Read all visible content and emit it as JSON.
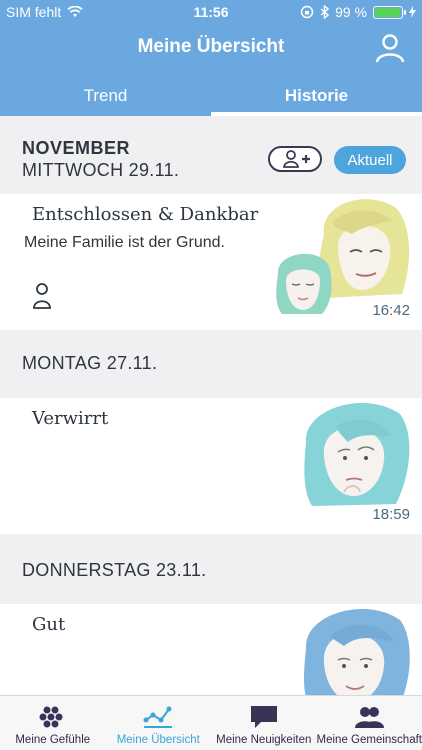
{
  "status": {
    "carrier": "SIM fehlt",
    "time": "11:56",
    "battery": "99 %"
  },
  "header": {
    "title": "Meine Übersicht"
  },
  "tabs": [
    {
      "label": "Trend"
    },
    {
      "label": "Historie"
    }
  ],
  "month_label": "NOVEMBER",
  "current_label": "Aktuell",
  "entries": [
    {
      "day": "MITTWOCH 29.11.",
      "mood": "Entschlossen & Dankbar",
      "note": "Meine Familie ist der Grund.",
      "time": "16:42"
    },
    {
      "day": "MONTAG 27.11.",
      "mood": "Verwirrt",
      "time": "18:59"
    },
    {
      "day": "DONNERSTAG 23.11.",
      "mood": "Gut"
    }
  ],
  "nav": [
    {
      "label": "Meine Gefühle",
      "icon": "dots-icon"
    },
    {
      "label": "Meine Übersicht",
      "icon": "chart-icon"
    },
    {
      "label": "Meine Neuigkeiten",
      "icon": "chat-icon"
    },
    {
      "label": "Meine Gemeinschaft",
      "icon": "group-icon"
    }
  ],
  "colors": {
    "header": "#6aa8df",
    "accent": "#3aa6d6",
    "nav_active": "#3aa6d6"
  }
}
